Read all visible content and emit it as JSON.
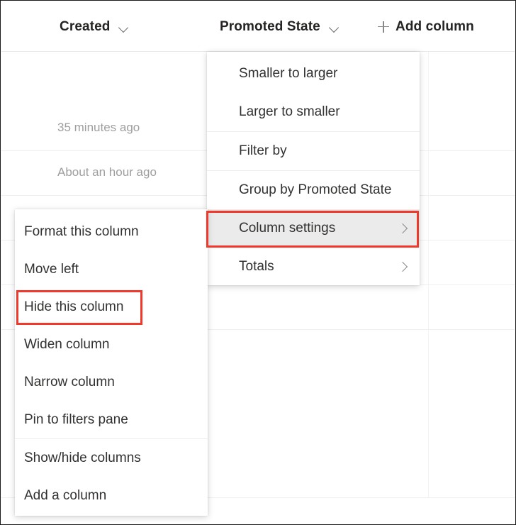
{
  "list_header": {
    "columns": [
      {
        "label": "Created",
        "icon": "chevron-down-icon"
      },
      {
        "label": "Promoted State",
        "icon": "chevron-down-icon"
      }
    ],
    "add_column": {
      "label": "Add column",
      "icon": "plus-icon"
    }
  },
  "rows": [
    {
      "created": "35 minutes ago"
    },
    {
      "created": "About an hour ago"
    }
  ],
  "promoted_state_menu": {
    "items": [
      {
        "label": "Smaller to larger",
        "submenu": false,
        "highlighted": false
      },
      {
        "label": "Larger to smaller",
        "submenu": false,
        "highlighted": false
      },
      {
        "label": "Filter by",
        "submenu": false,
        "highlighted": false
      },
      {
        "label": "Group by Promoted State",
        "submenu": false,
        "highlighted": false
      },
      {
        "label": "Column settings",
        "submenu": true,
        "highlighted": true
      },
      {
        "label": "Totals",
        "submenu": true,
        "highlighted": false
      }
    ]
  },
  "created_menu": {
    "items": [
      {
        "label": "Format this column",
        "submenu": false,
        "highlighted": false
      },
      {
        "label": "Move left",
        "submenu": false,
        "highlighted": false
      },
      {
        "label": "Hide this column",
        "submenu": false,
        "highlighted": false
      },
      {
        "label": "Widen column",
        "submenu": false,
        "highlighted": false
      },
      {
        "label": "Narrow column",
        "submenu": false,
        "highlighted": false
      },
      {
        "label": "Pin to filters pane",
        "submenu": false,
        "highlighted": false
      },
      {
        "label": "Show/hide columns",
        "submenu": false,
        "highlighted": false
      },
      {
        "label": "Add a column",
        "submenu": false,
        "highlighted": false
      }
    ]
  },
  "annotations": {
    "color": "#f0392b",
    "boxes": [
      {
        "target": "Column settings"
      },
      {
        "target": "Hide this column"
      }
    ]
  },
  "icons": {
    "chevron_down": "chevron-down-icon",
    "chevron_right": "chevron-right-icon",
    "plus": "plus-icon"
  }
}
